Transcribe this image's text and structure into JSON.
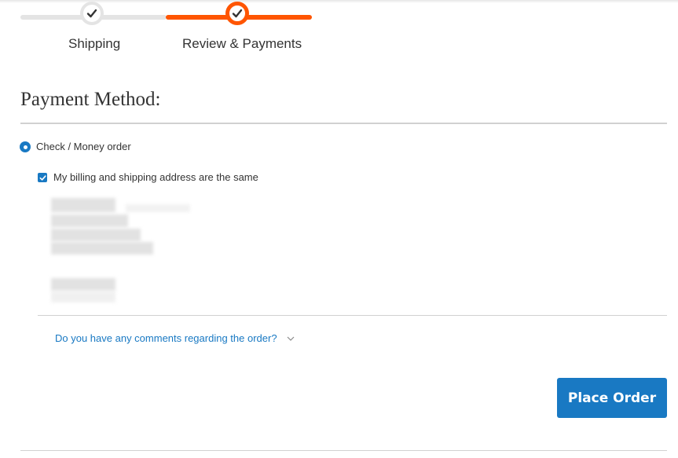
{
  "progress": {
    "steps": [
      {
        "label": "Shipping",
        "state": "complete"
      },
      {
        "label": "Review & Payments",
        "state": "active"
      }
    ],
    "colors": {
      "active": "#ff5501",
      "inactive": "#e4e4e4"
    }
  },
  "payment": {
    "title": "Payment Method:",
    "method_label": "Check / Money order",
    "method_selected": true,
    "same_address_label": "My billing and shipping address are the same",
    "same_address_checked": true
  },
  "comments": {
    "link_text": "Do you have any comments regarding the order?"
  },
  "actions": {
    "place_order_label": "Place Order"
  },
  "colors": {
    "primary": "#1979c3",
    "text": "#333333"
  }
}
